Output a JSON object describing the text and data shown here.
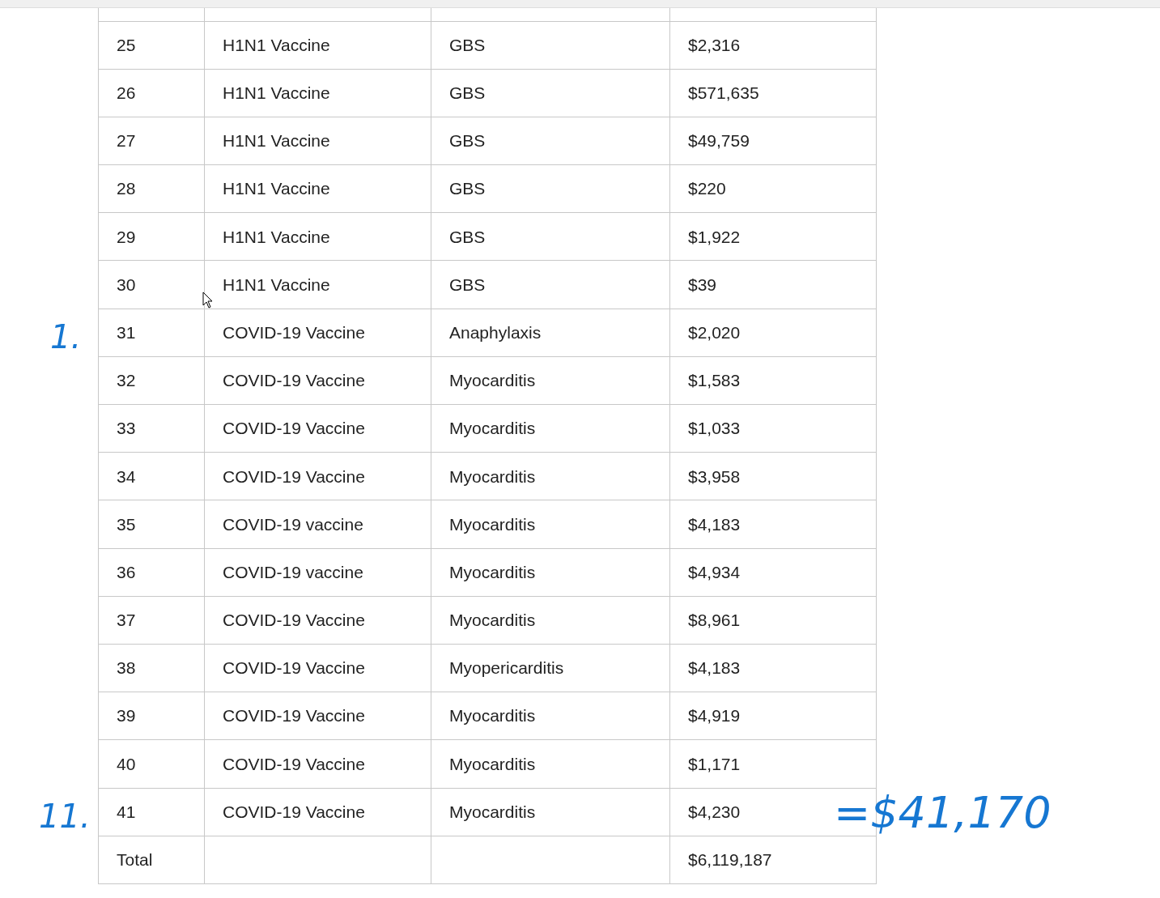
{
  "table": {
    "rows": [
      {
        "cells": [
          "25",
          "H1N1 Vaccine",
          "GBS",
          "$2,316"
        ]
      },
      {
        "cells": [
          "26",
          "H1N1 Vaccine",
          "GBS",
          "$571,635"
        ]
      },
      {
        "cells": [
          "27",
          "H1N1 Vaccine",
          "GBS",
          "$49,759"
        ]
      },
      {
        "cells": [
          "28",
          "H1N1 Vaccine",
          "GBS",
          "$220"
        ]
      },
      {
        "cells": [
          "29",
          "H1N1 Vaccine",
          "GBS",
          "$1,922"
        ]
      },
      {
        "cells": [
          "30",
          "H1N1 Vaccine",
          "GBS",
          "$39"
        ]
      },
      {
        "cells": [
          "31",
          "COVID-19 Vaccine",
          "Anaphylaxis",
          "$2,020"
        ]
      },
      {
        "cells": [
          "32",
          "COVID-19 Vaccine",
          "Myocarditis",
          "$1,583"
        ]
      },
      {
        "cells": [
          "33",
          "COVID-19 Vaccine",
          "Myocarditis",
          "$1,033"
        ]
      },
      {
        "cells": [
          "34",
          "COVID-19 Vaccine",
          "Myocarditis",
          "$3,958"
        ]
      },
      {
        "cells": [
          "35",
          "COVID-19 vaccine",
          "Myocarditis",
          "$4,183"
        ]
      },
      {
        "cells": [
          "36",
          "COVID-19 vaccine",
          "Myocarditis",
          "$4,934"
        ]
      },
      {
        "cells": [
          "37",
          "COVID-19 Vaccine",
          "Myocarditis",
          "$8,961"
        ]
      },
      {
        "cells": [
          "38",
          "COVID-19 Vaccine",
          "Myopericarditis",
          "$4,183"
        ]
      },
      {
        "cells": [
          "39",
          "COVID-19 Vaccine",
          "Myocarditis",
          "$4,919"
        ]
      },
      {
        "cells": [
          "40",
          "COVID-19 Vaccine",
          "Myocarditis",
          "$1,171"
        ]
      },
      {
        "cells": [
          "41",
          "COVID-19 Vaccine",
          "Myocarditis",
          "$4,230"
        ]
      },
      {
        "cells": [
          "Total",
          "",
          "",
          "$6,119,187"
        ]
      }
    ]
  },
  "handwritten_notes": [
    {
      "text": "1."
    },
    {
      "text": "11."
    },
    {
      "text": "=$41,170"
    }
  ]
}
